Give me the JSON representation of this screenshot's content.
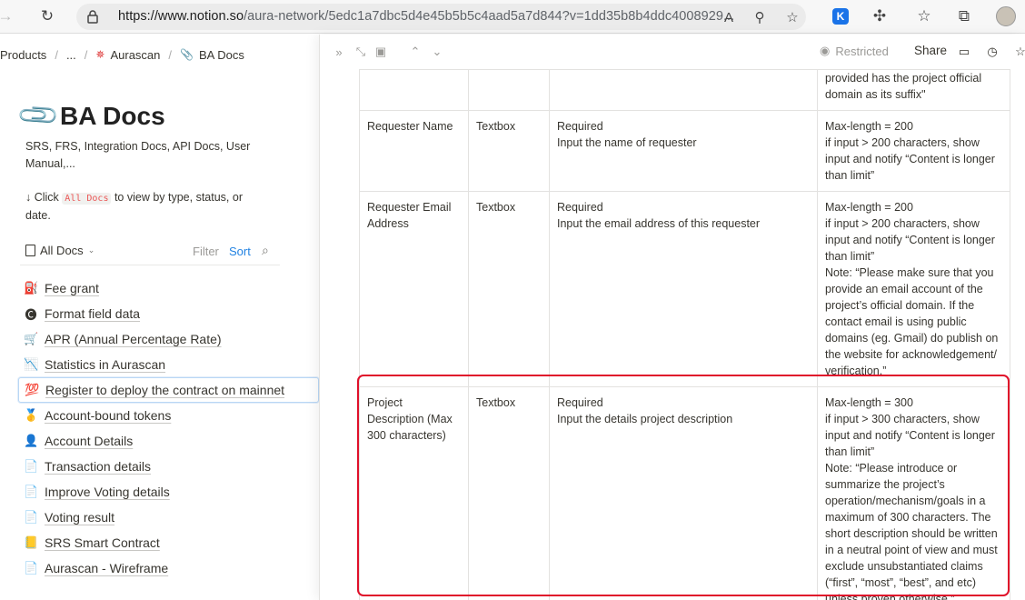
{
  "browser": {
    "url_host": "https://www.notion.so",
    "url_path": "/aura-network/5edc1a7dbc5d4e45b5b5c4aad5a7d844?v=1dd35b8b4ddc4008929..."
  },
  "breadcrumb": {
    "items": [
      "Products",
      "...",
      "Aurascan",
      "BA Docs"
    ]
  },
  "page": {
    "title": "BA Docs",
    "description": "SRS, FRS, Integration Docs, API Docs, User Manual,...",
    "hint_prefix": "↓ Click",
    "hint_code": "All Docs",
    "hint_suffix": "to view by type, status, or date."
  },
  "view": {
    "tab_label": "All Docs",
    "filter_label": "Filter",
    "sort_label": "Sort"
  },
  "docs": [
    {
      "emoji": "⛽",
      "title": "Fee grant"
    },
    {
      "emoji": "🅒",
      "title": "Format field data"
    },
    {
      "emoji": "🛒",
      "title": "APR (Annual Percentage Rate)"
    },
    {
      "emoji": "📉",
      "title": "Statistics in Aurascan"
    },
    {
      "emoji": "💯",
      "title": "Register to deploy the contract on mainnet"
    },
    {
      "emoji": "🥇",
      "title": "Account-bound tokens"
    },
    {
      "emoji": "👤",
      "title": "Account Details"
    },
    {
      "emoji": "📄",
      "title": "Transaction details"
    },
    {
      "emoji": "📄",
      "title": "Improve Voting details"
    },
    {
      "emoji": "📄",
      "title": "Voting result"
    },
    {
      "emoji": "📒",
      "title": "SRS Smart Contract"
    },
    {
      "emoji": "📄",
      "title": "Aurascan - Wireframe"
    }
  ],
  "panel": {
    "restricted_label": "Restricted",
    "share_label": "Share"
  },
  "table": {
    "rows": [
      {
        "field": "",
        "type": "",
        "required": "",
        "rule": "provided has the project official domain as its suffix\""
      },
      {
        "field": "Requester Name",
        "type": "Textbox",
        "required": "Required\nInput the name of requester",
        "rule": "Max-length = 200\nif input > 200 characters, show input and notify “Content is longer than limit”"
      },
      {
        "field": "Requester Email Address",
        "type": "Textbox",
        "required": "Required\nInput the email address of this requester",
        "rule": "Max-length = 200\nif input > 200 characters, show input and notify “Content is longer than limit”\nNote: “Please make sure that you provide an email account of the project’s official domain. If the contact email is using public domains (eg. Gmail) do publish on the website for acknowledgement/ verification.”"
      },
      {
        "field": "Project Description (Max 300 characters)",
        "type": "Textbox",
        "required": "Required\nInput the details project description",
        "rule": "Max-length = 300\nif input > 300 characters, show input and notify “Content is longer than limit”\nNote: “Please introduce or summarize the project’s operation/mechanism/goals in a maximum of 300 characters. The short description should be written in a neutral point of view and must exclude unsubstantiated claims (“first”, “most”, “best”, and etc) unless proven otherwise.”"
      }
    ]
  }
}
